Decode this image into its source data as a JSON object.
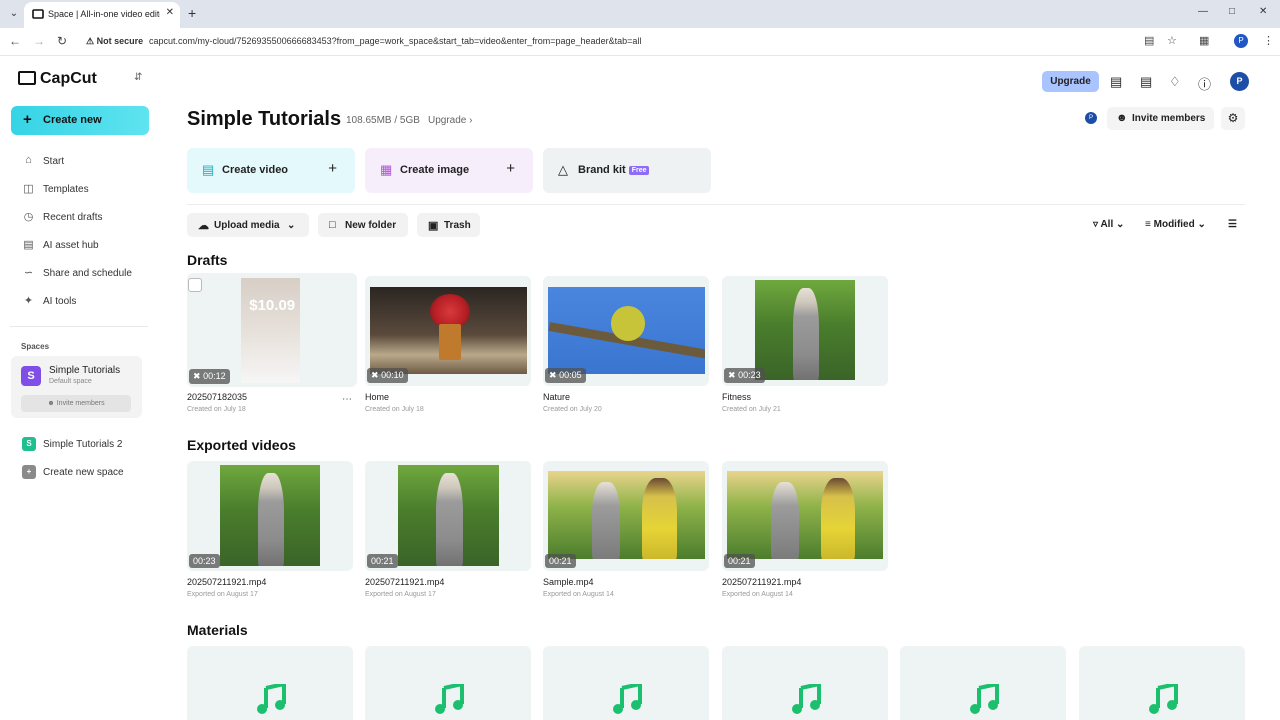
{
  "browser": {
    "tab_title": "Space | All-in-one video editor",
    "security": "Not secure",
    "url": "capcut.com/my-cloud/7526935500666683453?from_page=work_space&start_tab=video&enter_from=page_header&tab=all",
    "profile_initial": "P"
  },
  "app": {
    "logo": "CapCut",
    "create_new": "Create new",
    "nav": [
      {
        "label": "Start",
        "icon": "home-icon"
      },
      {
        "label": "Templates",
        "icon": "templates-icon"
      },
      {
        "label": "Recent drafts",
        "icon": "clock-icon"
      },
      {
        "label": "AI asset hub",
        "icon": "asset-hub-icon"
      },
      {
        "label": "Share and schedule",
        "icon": "share-icon"
      },
      {
        "label": "AI tools",
        "icon": "sparkle-icon"
      }
    ],
    "spaces_heading": "Spaces",
    "current_space": {
      "initial": "S",
      "name": "Simple Tutorials",
      "sub": "Default space",
      "invite": "Invite members"
    },
    "other_spaces": [
      {
        "initial": "S",
        "name": "Simple Tutorials 2",
        "color": "#1fbf8f"
      },
      {
        "initial": "+",
        "name": "Create new space",
        "color": "#8a8a8a"
      }
    ],
    "upgrade": "Upgrade",
    "user_initial": "P"
  },
  "header": {
    "title": "Simple Tutorials",
    "storage": "108.65MB / 5GB",
    "storage_upgrade": "Upgrade",
    "member_initial": "P",
    "invite_members": "Invite members"
  },
  "quick_actions": [
    {
      "label": "Create video",
      "color": "#e4f9fb",
      "icon": "film-icon"
    },
    {
      "label": "Create image",
      "color": "#f6eefb",
      "icon": "image-icon"
    },
    {
      "label": "Brand kit",
      "color": "#eef2f2",
      "icon": "brand-kit-icon",
      "tag": "Free"
    }
  ],
  "toolbar": {
    "upload": "Upload media",
    "new_folder": "New folder",
    "trash": "Trash",
    "filter": "All",
    "sort": "Modified"
  },
  "drafts": {
    "title": "Drafts",
    "items": [
      {
        "name": "202507182035",
        "sub": "Created on July 18",
        "duration": "00:12",
        "promo_price": "$10.09"
      },
      {
        "name": "Home",
        "sub": "Created on July 18",
        "duration": "00:10"
      },
      {
        "name": "Nature",
        "sub": "Created on July 20",
        "duration": "00:05"
      },
      {
        "name": "Fitness",
        "sub": "Created on July 21",
        "duration": "00:23"
      }
    ]
  },
  "exported": {
    "title": "Exported videos",
    "items": [
      {
        "name": "202507211921.mp4",
        "sub": "Exported on August 17",
        "duration": "00:23"
      },
      {
        "name": "202507211921.mp4",
        "sub": "Exported on August 17",
        "duration": "00:21"
      },
      {
        "name": "Sample.mp4",
        "sub": "Exported on August 14",
        "duration": "00:21"
      },
      {
        "name": "202507211921.mp4",
        "sub": "Exported on August 14",
        "duration": "00:21"
      }
    ]
  },
  "materials": {
    "title": "Materials",
    "icon": "music-note-icon",
    "accent": "#1bbf6d"
  }
}
